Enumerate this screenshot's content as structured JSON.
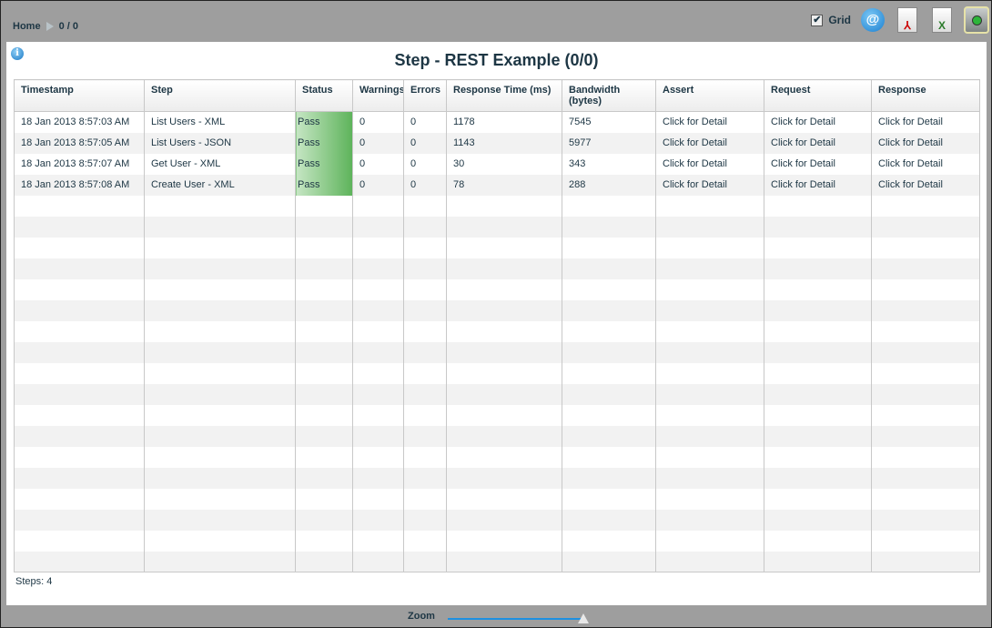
{
  "breadcrumb": {
    "home": "Home",
    "current": "0 / 0"
  },
  "toolbar": {
    "grid_label": "Grid",
    "grid_checked": true,
    "icons": [
      "email-icon",
      "pdf-export-icon",
      "excel-export-icon",
      "database-icon"
    ]
  },
  "title": "Step - REST Example (0/0)",
  "table": {
    "columns": [
      "Timestamp",
      "Step",
      "Status",
      "Warnings",
      "Errors",
      "Response Time (ms)",
      "Bandwidth (bytes)",
      "Assert",
      "Request",
      "Response"
    ],
    "rows": [
      [
        "18 Jan 2013 8:57:03 AM",
        "List Users - XML",
        "Pass",
        "0",
        "0",
        "1178",
        "7545",
        "Click for Detail",
        "Click for Detail",
        "Click for Detail"
      ],
      [
        "18 Jan 2013 8:57:05 AM",
        "List Users - JSON",
        "Pass",
        "0",
        "0",
        "1143",
        "5977",
        "Click for Detail",
        "Click for Detail",
        "Click for Detail"
      ],
      [
        "18 Jan 2013 8:57:07 AM",
        "Get User - XML",
        "Pass",
        "0",
        "0",
        "30",
        "343",
        "Click for Detail",
        "Click for Detail",
        "Click for Detail"
      ],
      [
        "18 Jan 2013 8:57:08 AM",
        "Create User - XML",
        "Pass",
        "0",
        "0",
        "78",
        "288",
        "Click for Detail",
        "Click for Detail",
        "Click for Detail"
      ]
    ]
  },
  "footer": {
    "steps": "Steps: 4"
  },
  "zoom": {
    "label": "Zoom",
    "value_percent": 100
  },
  "colors": {
    "pass": "#5db35a",
    "slider": "#1e90e0"
  }
}
